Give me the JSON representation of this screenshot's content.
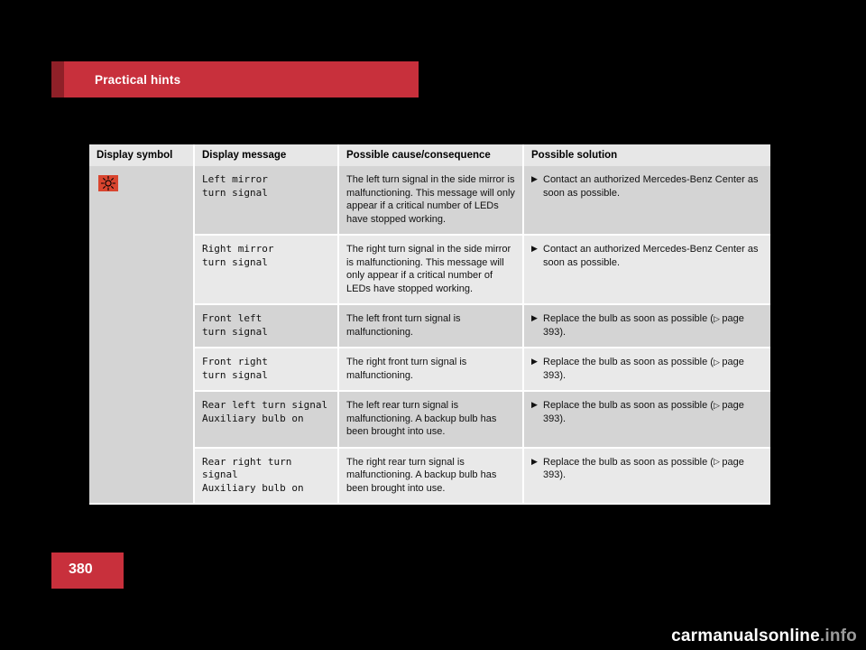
{
  "header": {
    "title": "Practical hints"
  },
  "page_number": "380",
  "watermark": {
    "main": "carmanualsonline",
    "suffix": ".info"
  },
  "table": {
    "headers": [
      "Display symbol",
      "Display message",
      "Possible cause/consequence",
      "Possible solution"
    ],
    "symbol_name": "turn-signal-indicator-symbol",
    "rows": [
      {
        "message": "Left mirror\nturn signal",
        "cause": "The left turn signal in the side mirror is malfunctioning. This message will only appear if a critical number of LEDs have stopped working.",
        "solution": "Contact an authorized Mercedes-Benz Center as soon as possible."
      },
      {
        "message": "Right mirror\nturn signal",
        "cause": "The right turn signal in the side mirror is malfunctioning. This message will only appear if a critical number of LEDs have stopped working.",
        "solution": "Contact an authorized Mercedes-Benz Center as soon as possible."
      },
      {
        "message": "Front left\nturn signal",
        "cause": "The left front turn signal is malfunctioning.",
        "solution_prefix": "Replace the bulb as soon as possible (",
        "solution_page": "page 393",
        "solution_suffix": ")."
      },
      {
        "message": "Front right\nturn signal",
        "cause": "The right front turn signal is malfunctioning.",
        "solution_prefix": "Replace the bulb as soon as possible (",
        "solution_page": "page 393",
        "solution_suffix": ")."
      },
      {
        "message": "Rear left turn signal\nAuxiliary bulb on",
        "cause": "The left rear turn signal is malfunctioning. A backup bulb has been brought into use.",
        "solution_prefix": "Replace the bulb as soon as possible (",
        "solution_page": "page 393",
        "solution_suffix": ")."
      },
      {
        "message": "Rear right turn signal\nAuxiliary bulb on",
        "cause": "The right rear turn signal is malfunctioning. A backup bulb has been brought into use.",
        "solution_prefix": "Replace the bulb as soon as possible (",
        "solution_page": "page 393",
        "solution_suffix": ")."
      }
    ]
  },
  "colors": {
    "accent_red": "#c8303c",
    "accent_red_dark": "#8f2028",
    "header_row": "#e7e7e7",
    "cell_dark": "#d4d4d4",
    "cell_light": "#e9e9e9"
  }
}
